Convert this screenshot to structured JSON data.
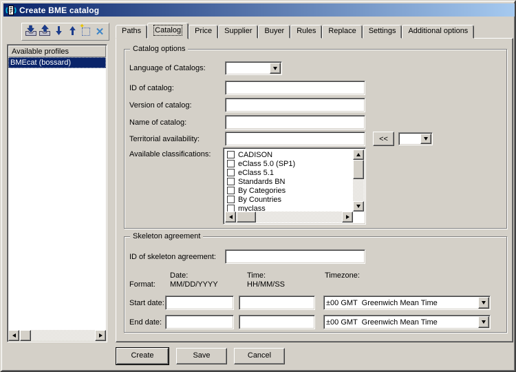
{
  "window": {
    "title": "Create BME catalog"
  },
  "toolbar": {
    "buttons": [
      {
        "name": "import-profile",
        "icon": "tray-import-icon"
      },
      {
        "name": "export-profile",
        "icon": "tray-export-icon"
      },
      {
        "name": "move-down",
        "icon": "down-arrow-icon"
      },
      {
        "name": "move-up",
        "icon": "up-arrow-icon"
      },
      {
        "name": "new-profile",
        "icon": "new-item-icon"
      },
      {
        "name": "delete-profile",
        "icon": "delete-x-icon"
      }
    ]
  },
  "profiles": {
    "header": "Available profiles",
    "items": [
      {
        "label": "BMEcat (bossard)",
        "selected": true
      }
    ]
  },
  "tabs": [
    {
      "label": "Paths"
    },
    {
      "label": "Catalog",
      "active": true
    },
    {
      "label": "Price"
    },
    {
      "label": "Supplier"
    },
    {
      "label": "Buyer"
    },
    {
      "label": "Rules"
    },
    {
      "label": "Replace"
    },
    {
      "label": "Settings"
    },
    {
      "label": "Additional options"
    }
  ],
  "catalog_options": {
    "title": "Catalog options",
    "language_label": "Language of Catalogs:",
    "id_label": "ID of catalog:",
    "version_label": "Version of catalog:",
    "name_label": "Name of catalog:",
    "territorial_label": "Territorial availability:",
    "move_left_button": "<<",
    "classifications_label": "Available classifications:",
    "classifications": [
      "CADISON",
      "eClass 5.0 (SP1)",
      "eClass 5.1",
      "Standards BN",
      "By Categories",
      "By Countries",
      "myclass"
    ]
  },
  "skeleton_agreement": {
    "title": "Skeleton agreement",
    "id_label": "ID of skeleton agreement:",
    "format_label": "Format:",
    "date_label": "Date:",
    "date_format": "MM/DD/YYYY",
    "time_label": "Time:",
    "time_format": "HH/MM/SS",
    "timezone_label": "Timezone:",
    "start_date_label": "Start date:",
    "end_date_label": "End date:",
    "start_timezone": "±00 GMT  Greenwich Mean Time",
    "end_timezone": "±00 GMT  Greenwich Mean Time"
  },
  "action_buttons": {
    "create": "Create",
    "save": "Save",
    "cancel": "Cancel"
  },
  "colors": {
    "titlebar_start": "#0A246A",
    "titlebar_end": "#A6CAF0",
    "selection": "#0A246A",
    "face": "#D4D0C8",
    "delete_icon": "#3D85C8",
    "arrow_icon": "#1B3C8C"
  }
}
